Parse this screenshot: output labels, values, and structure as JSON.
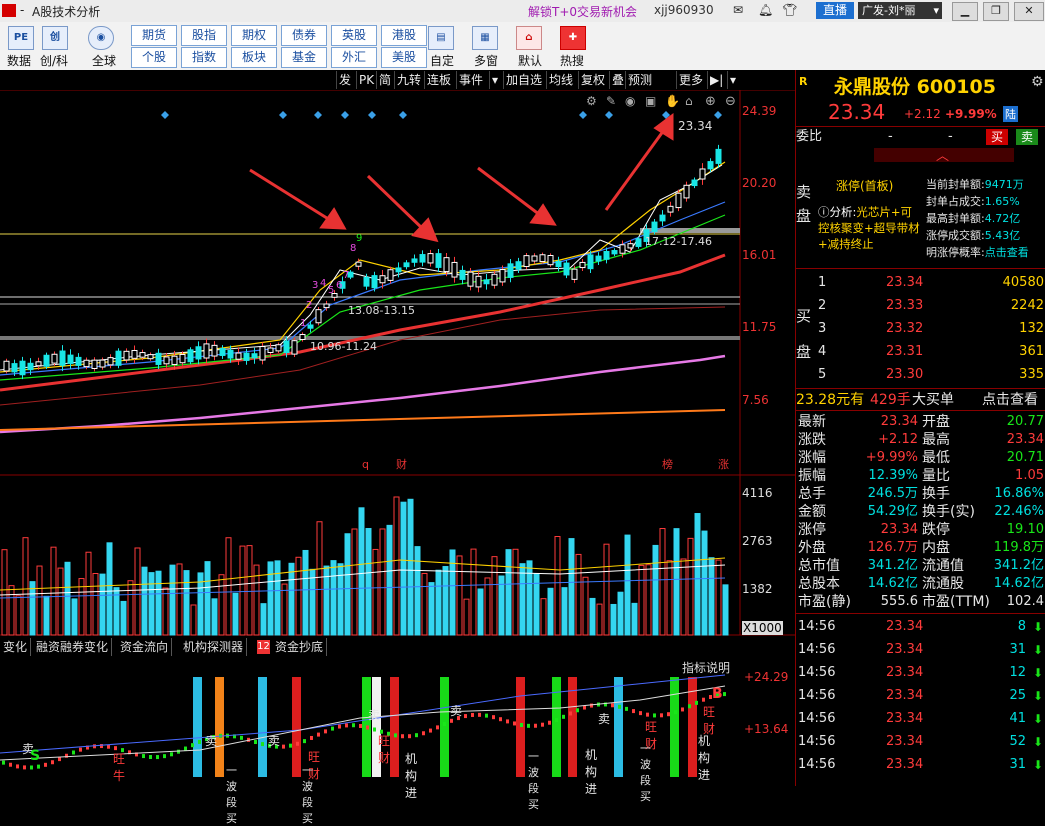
{
  "titlebar": {
    "left_title": "A股技术分析",
    "promo": "解锁T+0交易新机会",
    "user": "xjj960930",
    "live_btn": "直播",
    "account": "广发-刘*丽"
  },
  "toolbar": {
    "icons": [
      {
        "name": "data",
        "label": "数据",
        "glyph": "PE"
      },
      {
        "name": "chuangke",
        "label": "创/科",
        "glyph": "创"
      },
      {
        "name": "global",
        "label": "全球",
        "glyph": "◉"
      },
      {
        "name": "custom",
        "label": "自定",
        "glyph": "▤"
      },
      {
        "name": "multiwin",
        "label": "多窗",
        "glyph": "▦"
      },
      {
        "name": "default",
        "label": "默认",
        "glyph": "⌂"
      },
      {
        "name": "hotsearch",
        "label": "热搜",
        "glyph": "✚"
      }
    ],
    "market_buttons_row1": [
      "期货",
      "股指",
      "期权",
      "债券",
      "英股",
      "港股"
    ],
    "market_buttons_row2": [
      "个股",
      "指数",
      "板块",
      "基金",
      "外汇",
      "美股"
    ]
  },
  "chart_toolbar": [
    "发",
    "PK",
    "简",
    "九转",
    "连板",
    "事件",
    "加自选",
    "均线",
    "复权",
    "叠",
    "预测",
    "更多"
  ],
  "stock": {
    "name": "永鼎股份",
    "code": "600105",
    "price": "23.34",
    "change": "+2.12",
    "change_pct": "+9.99%",
    "tag": "陆",
    "r_icon": "R"
  },
  "weibi": {
    "label": "委比",
    "v1": "-",
    "v2": "-",
    "buy": "买",
    "sell": "卖"
  },
  "limit_up": {
    "sell_label": "卖盘",
    "title": "涨停(首板)",
    "analysis_label": "分析:",
    "analysis_text": "光芯片+可控核聚变+超导带材+减持终止",
    "stats": [
      {
        "k": "当前封单额:",
        "v": "9471万"
      },
      {
        "k": "封单占成交:",
        "v": "1.65%"
      },
      {
        "k": "最高封单额:",
        "v": "4.72亿"
      },
      {
        "k": "涨停成交额:",
        "v": "5.43亿"
      },
      {
        "k": "明涨停概率:",
        "v": "点击查看"
      }
    ]
  },
  "buy_book": {
    "label": "买盘",
    "rows": [
      {
        "lvl": "1",
        "price": "23.34",
        "vol": "40580"
      },
      {
        "lvl": "2",
        "price": "23.33",
        "vol": "2242"
      },
      {
        "lvl": "3",
        "price": "23.32",
        "vol": "132"
      },
      {
        "lvl": "4",
        "price": "23.31",
        "vol": "361"
      },
      {
        "lvl": "5",
        "price": "23.30",
        "vol": "335"
      }
    ]
  },
  "big_order": {
    "price": "23.28元有",
    "lots": "429手",
    "label": "大买单",
    "link": "点击查看"
  },
  "quote": [
    {
      "k1": "最新",
      "v1": "23.34",
      "c1": "red",
      "k2": "开盘",
      "v2": "20.77",
      "c2": "green"
    },
    {
      "k1": "涨跌",
      "v1": "+2.12",
      "c1": "red",
      "k2": "最高",
      "v2": "23.34",
      "c2": "red"
    },
    {
      "k1": "涨幅",
      "v1": "+9.99%",
      "c1": "red",
      "k2": "最低",
      "v2": "20.71",
      "c2": "green"
    },
    {
      "k1": "振幅",
      "v1": "12.39%",
      "c1": "cyan",
      "k2": "量比",
      "v2": "1.05",
      "c2": "red"
    },
    {
      "k1": "总手",
      "v1": "246.5万",
      "c1": "cyan",
      "k2": "换手",
      "v2": "16.86%",
      "c2": "cyan"
    },
    {
      "k1": "金额",
      "v1": "54.29亿",
      "c1": "cyan",
      "k2": "换手(实)",
      "v2": "22.46%",
      "c2": "cyan"
    },
    {
      "k1": "涨停",
      "v1": "23.34",
      "c1": "red",
      "k2": "跌停",
      "v2": "19.10",
      "c2": "green"
    },
    {
      "k1": "外盘",
      "v1": "126.7万",
      "c1": "red",
      "k2": "内盘",
      "v2": "119.8万",
      "c2": "green"
    },
    {
      "k1": "总市值",
      "v1": "341.2亿",
      "c1": "cyan",
      "k2": "流通值",
      "v2": "341.2亿",
      "c2": "cyan"
    },
    {
      "k1": "总股本",
      "v1": "14.62亿",
      "c1": "cyan",
      "k2": "流通股",
      "v2": "14.62亿",
      "c2": "cyan"
    },
    {
      "k1": "市盈(静)",
      "v1": "555.6",
      "c1": "white",
      "k2": "市盈(TTM)",
      "v2": "102.4",
      "c2": "white"
    }
  ],
  "ticks": [
    {
      "time": "14:56",
      "price": "23.34",
      "vol": "8"
    },
    {
      "time": "14:56",
      "price": "23.34",
      "vol": "31"
    },
    {
      "time": "14:56",
      "price": "23.34",
      "vol": "12"
    },
    {
      "time": "14:56",
      "price": "23.34",
      "vol": "25"
    },
    {
      "time": "14:56",
      "price": "23.34",
      "vol": "41"
    },
    {
      "time": "14:56",
      "price": "23.34",
      "vol": "52"
    },
    {
      "time": "14:56",
      "price": "23.34",
      "vol": "31"
    }
  ],
  "price_axis": [
    "24.39",
    "20.20",
    "16.01",
    "11.75",
    "7.56"
  ],
  "price_labels": {
    "high": "23.34",
    "zone1": "17.12-17.46",
    "zone2": "13.08-13.15",
    "zone3": "10.96-11.24",
    "nine_turn": [
      "1",
      "2",
      "3",
      "4",
      "5",
      "6",
      "7",
      "8",
      "9"
    ],
    "events": {
      "q": "q",
      "cai": "财",
      "bang": "榜",
      "zhang": "涨"
    }
  },
  "volume_axis": [
    "4116",
    "2763",
    "1382"
  ],
  "volume_unit": "X1000",
  "bottom_tabs": [
    "变化",
    "融资融券变化",
    "资金流向",
    "机构探测器",
    "资金抄底"
  ],
  "indicator": {
    "help": "指标说明",
    "axis": [
      "+24.29",
      "+13.64"
    ],
    "badge": "12",
    "labels": [
      "卖",
      "卖",
      "卖",
      "卖",
      "卖",
      "卖",
      "旺财",
      "旺财",
      "旺财",
      "旺财",
      "一波段买",
      "一波段买",
      "一波段买",
      "一波段买",
      "机构进",
      "机构进",
      "机构进",
      "旺牛",
      "S",
      "B"
    ]
  },
  "colors": {
    "up": "#ff3b3b",
    "down": "#19e619",
    "bg": "#000000",
    "ma_white": "#ffffff",
    "ma_yellow": "#ffd200",
    "ma_red": "#e83232",
    "ma_pink": "#e679e6",
    "ma_orange": "#ff7a1a",
    "vol_cyan": "#34d6f0"
  }
}
